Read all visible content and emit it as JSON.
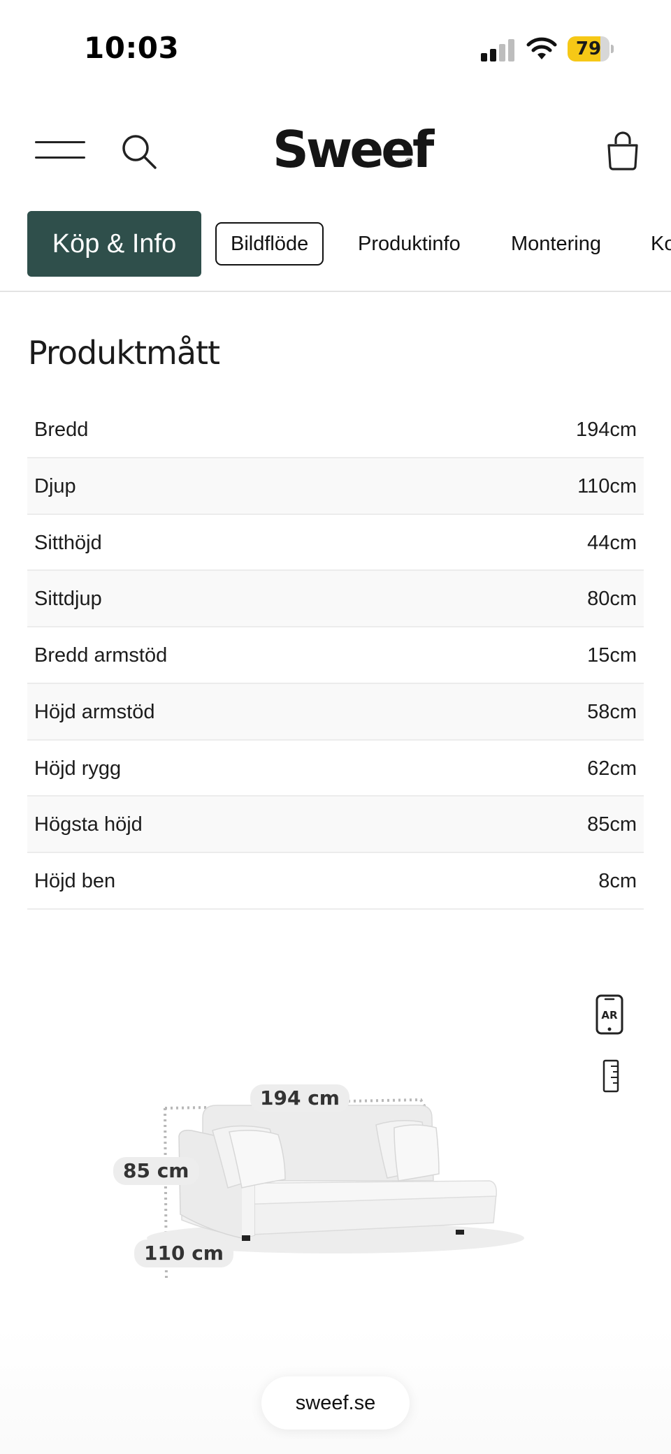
{
  "status_bar": {
    "time": "10:03",
    "battery": "79",
    "battery_level": 0.79,
    "battery_color": "#f6c816"
  },
  "header": {
    "logo": "Sweef",
    "logo_mark": "®",
    "icons": [
      "menu-icon",
      "search-icon",
      "bag-icon"
    ]
  },
  "tabs": [
    {
      "label": "Köp & Info",
      "state": "active"
    },
    {
      "label": "Bildflöde",
      "state": "outlined"
    },
    {
      "label": "Produktinfo",
      "state": "normal"
    },
    {
      "label": "Montering",
      "state": "normal"
    },
    {
      "label": "Ko",
      "state": "normal"
    }
  ],
  "colors": {
    "active_tab": "#2f4f4b"
  },
  "section": {
    "title": "Produktmått"
  },
  "dimensions": [
    {
      "label": "Bredd",
      "value": "194cm"
    },
    {
      "label": "Djup",
      "value": "110cm"
    },
    {
      "label": "Sitthöjd",
      "value": "44cm"
    },
    {
      "label": "Sittdjup",
      "value": "80cm"
    },
    {
      "label": "Bredd armstöd",
      "value": "15cm"
    },
    {
      "label": "Höjd armstöd",
      "value": "58cm"
    },
    {
      "label": "Höjd rygg",
      "value": "62cm"
    },
    {
      "label": "Högsta höjd",
      "value": "85cm"
    },
    {
      "label": "Höjd ben",
      "value": "8cm"
    }
  ],
  "product_visual": {
    "ar_icon_label": "AR",
    "width_label": "194 cm",
    "height_label": "85 cm",
    "depth_label": "110 cm"
  },
  "footer": {
    "url": "sweef.se"
  }
}
